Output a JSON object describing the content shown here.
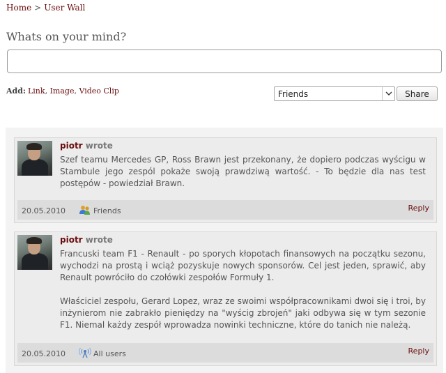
{
  "breadcrumb": {
    "home": "Home",
    "separator": ">",
    "current": "User Wall"
  },
  "composer": {
    "title": "Whats on your mind?",
    "status_value": "",
    "add_label": "Add:",
    "attach_links": [
      "Link",
      "Image",
      "Video Clip"
    ],
    "visibility_selected": "Friends",
    "share_label": "Share"
  },
  "posts": [
    {
      "author": "piotr",
      "verb": "wrote",
      "paragraphs": [
        "Szef teamu Mercedes GP, Ross Brawn jest przekonany, że dopiero podczas wyścigu w Stambule jego zespól pokaże swoją prawdziwą wartość. - To będzie dla nas test postępów - powiedział Brawn."
      ],
      "date": "20.05.2010",
      "visibility": "Friends",
      "visibility_icon": "friends-icon",
      "reply_label": "Reply"
    },
    {
      "author": "piotr",
      "verb": "wrote",
      "paragraphs": [
        "Francuski team F1 - Renault - po sporych kłopotach finansowych na początku sezonu, wychodzi na prostą i wciąż pozyskuje nowych sponsorów. Cel jest jeden, sprawić, aby Renault powróciło do czołówki zespołów Formuły 1.",
        "Właściciel zespołu, Gerard Lopez, wraz ze swoimi współpracownikami dwoi się i troi, by inżynierom nie zabrakło pieniędzy na \"wyścig zbrojeń\" jaki odbywa się w tym sezonie F1. Niemal każdy zespół wprowadza nowinki techniczne, które do tanich nie należą."
      ],
      "date": "20.05.2010",
      "visibility": "All users",
      "visibility_icon": "broadcast-icon",
      "reply_label": "Reply"
    }
  ]
}
